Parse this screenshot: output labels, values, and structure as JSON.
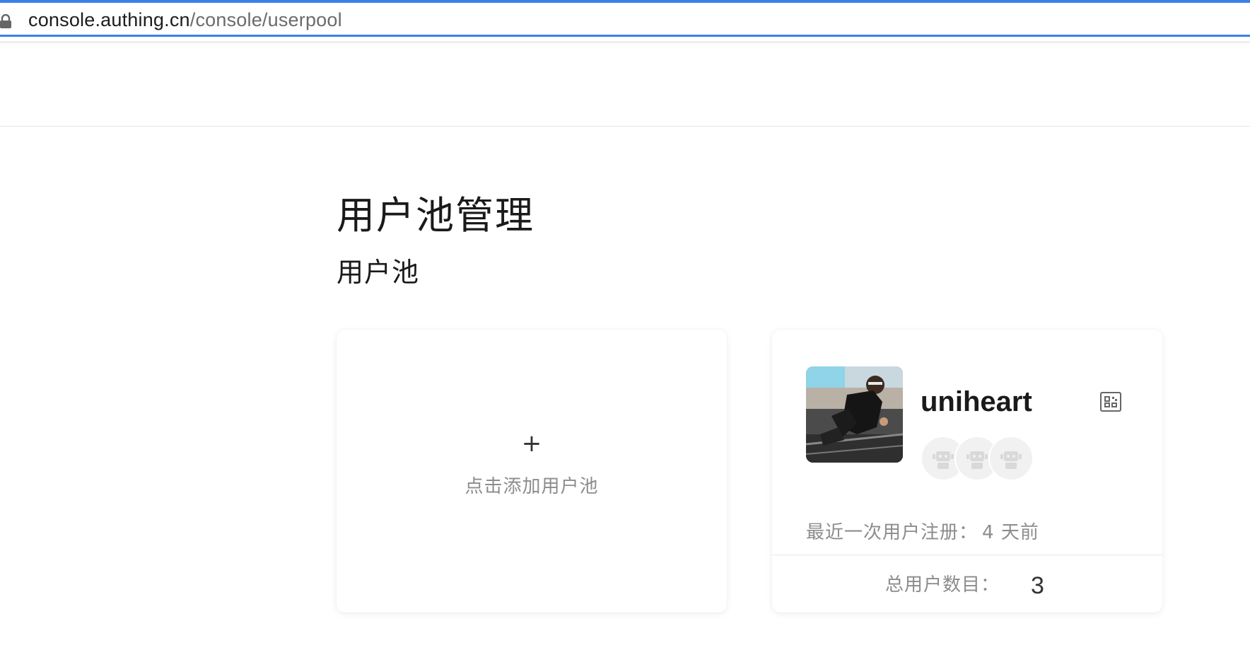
{
  "browser": {
    "url_domain": "console.authing.cn",
    "url_path": "/console/userpool",
    "lock_icon": "lock-icon"
  },
  "page": {
    "title": "用户池管理",
    "section_title": "用户池"
  },
  "add_card": {
    "plus": "+",
    "label": "点击添加用户池"
  },
  "pool_card": {
    "name": "uniheart",
    "qr_icon": "qr-code-icon",
    "user_avatar_icon": "robot-avatar-icon",
    "last_register_label": "最近一次用户注册：",
    "last_register_value": "4 天前",
    "total_users_label": "总用户数目：",
    "total_users_value": "3"
  },
  "colors": {
    "accent": "#3b82e6",
    "muted_text": "#8c8c8c",
    "title_text": "#1a1a1a"
  }
}
